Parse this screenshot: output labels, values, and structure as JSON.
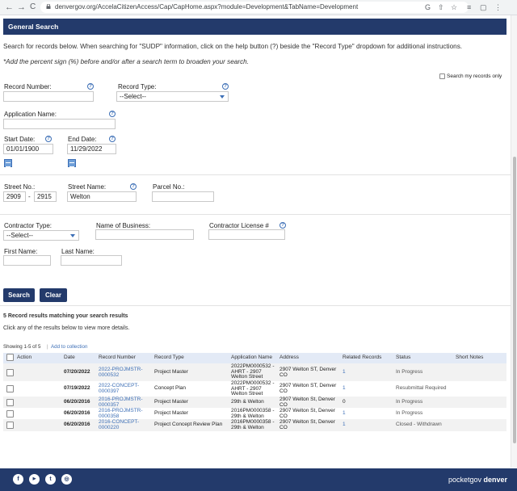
{
  "browser": {
    "back_icon": "←",
    "forward_icon": "→",
    "reload_icon": "C",
    "url": "denvergov.org/AccelaCitizenAccess/Cap/CapHome.aspx?module=Development&TabName=Development",
    "icons": [
      "G",
      "⇧",
      "☆",
      "≡",
      "▢",
      "▮"
    ]
  },
  "header": {
    "title": "General Search"
  },
  "instructions": {
    "line1": "Search for records below. When searching for \"SUDP\" information, click on the help button (?) beside the \"Record Type\" dropdown for additional instructions.",
    "line2": "*Add the percent sign (%) before and/or after a search term to broaden your search."
  },
  "form": {
    "search_my_records": "Search my records only",
    "record_number_label": "Record Number:",
    "record_type_label": "Record Type:",
    "record_type_value": "--Select--",
    "application_name_label": "Application Name:",
    "start_date_label": "Start Date:",
    "start_date_value": "01/01/1900",
    "end_date_label": "End Date:",
    "end_date_value": "11/29/2022",
    "street_no_label": "Street No.:",
    "street_no_from": "2909",
    "street_no_sep": "-",
    "street_no_to": "2915",
    "street_name_label": "Street Name:",
    "street_name_value": "Welton",
    "parcel_no_label": "Parcel No.:",
    "contractor_type_label": "Contractor Type:",
    "contractor_type_value": "--Select--",
    "business_name_label": "Name of Business:",
    "contractor_license_label": "Contractor License #",
    "first_name_label": "First Name:",
    "last_name_label": "Last Name:",
    "help_glyph": "?",
    "search_button": "Search",
    "clear_button": "Clear"
  },
  "results": {
    "summary": "5 Record results matching your search results",
    "hint": "Click any of the results below to view more details.",
    "showing": "Showing 1-5 of 5",
    "separator": "|",
    "add_to_collection": "Add to collection",
    "columns": [
      "Action",
      "Date",
      "Record Number",
      "Record Type",
      "Application Name",
      "Address",
      "Related Records",
      "Status",
      "Short Notes"
    ],
    "rows": [
      {
        "date": "07/20/2022",
        "record": [
          "2022-PROJMSTR-",
          "0000532"
        ],
        "type": "Project Master",
        "app": [
          "2022PM0000532 -",
          "AHRT - 2907",
          "Welton Street"
        ],
        "address": [
          "2907 Welton ST, Denver",
          "CO"
        ],
        "related": "1",
        "status": "In Progress"
      },
      {
        "date": "07/19/2022",
        "record": [
          "2022-CONCEPT-",
          "0000397"
        ],
        "type": "Concept Plan",
        "app": [
          "2022PM0000532 -",
          "AHRT - 2907",
          "Welton Street"
        ],
        "address": [
          "2907 Welton ST, Denver",
          "CO"
        ],
        "related": "1",
        "status": "Resubmittal Required"
      },
      {
        "date": "06/20/2016",
        "record": [
          "2016-PROJMSTR-",
          "0000357"
        ],
        "type": "Project Master",
        "app": [
          "29th & Welton"
        ],
        "address": [
          "2907 Welton St, Denver",
          "CO"
        ],
        "related": "0",
        "status": "In Progress"
      },
      {
        "date": "06/20/2016",
        "record": [
          "2016-PROJMSTR-",
          "0000358"
        ],
        "type": "Project Master",
        "app": [
          "2016PM0000358 -",
          "29th & Welton"
        ],
        "address": [
          "2907 Welton St, Denver",
          "CO"
        ],
        "related": "1",
        "status": "In Progress"
      },
      {
        "date": "06/20/2016",
        "record": [
          "2016-CONCEPT-",
          "0000220"
        ],
        "type": "Project Concept Review Plan",
        "app": [
          "2016PM0000358 -",
          "29th & Welton"
        ],
        "address": [
          "2907 Welton St, Denver",
          "CO"
        ],
        "related": "1",
        "status": "Closed - Withdrawn"
      }
    ]
  },
  "footer": {
    "social": [
      "f",
      "▶",
      "t",
      "◎"
    ],
    "social_names": [
      "facebook-icon",
      "youtube-icon",
      "twitter-icon",
      "instagram-icon"
    ],
    "brand_light": "pocketgov ",
    "brand_bold": "denver"
  },
  "colors": {
    "header": "#233a6b",
    "link": "#3d6fb6"
  }
}
